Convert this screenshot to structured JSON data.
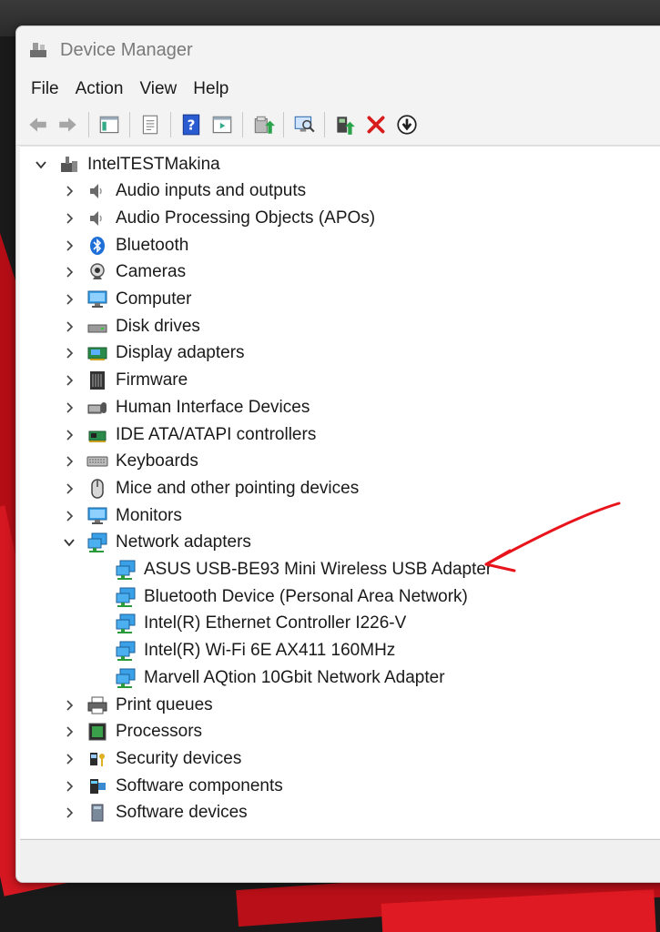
{
  "window": {
    "title": "Device Manager"
  },
  "menu": [
    "File",
    "Action",
    "View",
    "Help"
  ],
  "toolbar": [
    {
      "name": "back-button",
      "icon": "arrow-left-icon"
    },
    {
      "name": "forward-button",
      "icon": "arrow-right-icon"
    },
    {
      "sep": true
    },
    {
      "name": "show-hide-console-tree-button",
      "icon": "console-tree-icon"
    },
    {
      "sep": true
    },
    {
      "name": "properties-button",
      "icon": "properties-icon"
    },
    {
      "sep": true
    },
    {
      "name": "help-button",
      "icon": "help-icon"
    },
    {
      "name": "show-action-pane-button",
      "icon": "action-pane-icon"
    },
    {
      "sep": true
    },
    {
      "name": "update-driver-button",
      "icon": "update-driver-icon"
    },
    {
      "sep": true
    },
    {
      "name": "scan-for-hardware-changes-button",
      "icon": "scan-monitor-icon"
    },
    {
      "sep": true
    },
    {
      "name": "enable-device-button",
      "icon": "enable-device-icon"
    },
    {
      "name": "uninstall-device-button",
      "icon": "red-x-icon"
    },
    {
      "name": "disable-device-button",
      "icon": "down-arrow-circle-icon"
    }
  ],
  "tree": {
    "root": "IntelTESTMakina",
    "categories": [
      {
        "label": "Audio inputs and outputs",
        "icon": "speaker-icon"
      },
      {
        "label": "Audio Processing Objects (APOs)",
        "icon": "speaker-icon"
      },
      {
        "label": "Bluetooth",
        "icon": "bluetooth-icon"
      },
      {
        "label": "Cameras",
        "icon": "camera-icon"
      },
      {
        "label": "Computer",
        "icon": "monitor-icon"
      },
      {
        "label": "Disk drives",
        "icon": "disk-drive-icon"
      },
      {
        "label": "Display adapters",
        "icon": "display-adapter-icon"
      },
      {
        "label": "Firmware",
        "icon": "firmware-chip-icon"
      },
      {
        "label": "Human Interface Devices",
        "icon": "hid-icon"
      },
      {
        "label": "IDE ATA/ATAPI controllers",
        "icon": "ide-controller-icon"
      },
      {
        "label": "Keyboards",
        "icon": "keyboard-icon"
      },
      {
        "label": "Mice and other pointing devices",
        "icon": "mouse-icon"
      },
      {
        "label": "Monitors",
        "icon": "monitor-icon"
      },
      {
        "label": "Network adapters",
        "icon": "network-adapter-icon",
        "expanded": true,
        "children": [
          "ASUS USB-BE93 Mini Wireless USB Adapter",
          "Bluetooth Device (Personal Area Network)",
          "Intel(R) Ethernet Controller I226-V",
          "Intel(R) Wi-Fi 6E AX411 160MHz",
          "Marvell AQtion 10Gbit Network Adapter"
        ]
      },
      {
        "label": "Print queues",
        "icon": "printer-icon"
      },
      {
        "label": "Processors",
        "icon": "processor-icon"
      },
      {
        "label": "Security devices",
        "icon": "security-device-icon"
      },
      {
        "label": "Software components",
        "icon": "software-component-icon"
      },
      {
        "label": "Software devices",
        "icon": "software-device-icon"
      }
    ]
  },
  "colors": {
    "annotation_arrow": "#e8141c",
    "tree_bg": "#ffffff",
    "window_bg": "#f3f3f3"
  }
}
